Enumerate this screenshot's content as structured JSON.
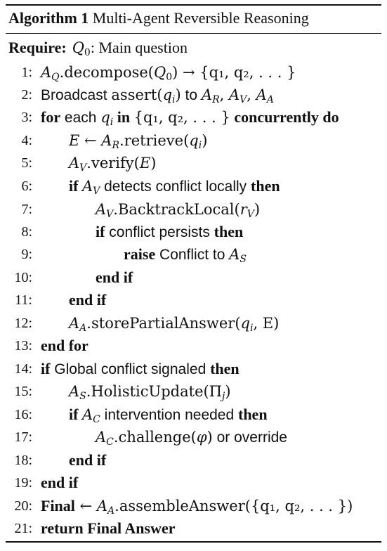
{
  "caption": {
    "label": "Algorithm 1",
    "title": "Multi-Agent Reversible Reasoning"
  },
  "require": {
    "keyword": "Require:",
    "q": "Q",
    "q_sub": "0",
    "text": ": Main question"
  },
  "numbers": [
    "1:",
    "2:",
    "3:",
    "4:",
    "5:",
    "6:",
    "7:",
    "8:",
    "9:",
    "10:",
    "11:",
    "12:",
    "13:",
    "14:",
    "15:",
    "16:",
    "17:",
    "18:",
    "19:",
    "20:",
    "21:"
  ],
  "l1": {
    "a": "A",
    "a_sub": "Q",
    "call": ".decompose(",
    "q": "Q",
    "q_sub": "0",
    "rest": ") → {q₁, q₂, . . . }"
  },
  "l2": {
    "text1": "Broadcast ",
    "fn": "assert(",
    "q": "q",
    "q_sub": "i",
    "close": ")",
    "text2": " to ",
    "targets": [
      {
        "a": "A",
        "sub": "R",
        "sep": ", "
      },
      {
        "a": "A",
        "sub": "V",
        "sep": ", "
      },
      {
        "a": "A",
        "sub": "A",
        "sep": ""
      }
    ]
  },
  "l3": {
    "kw_for": "for",
    "text_each": " each ",
    "q": "q",
    "q_sub": "i",
    "kw_in": " in ",
    "set": "{q₁, q₂, . . . }",
    "kw_do": " concurrently do"
  },
  "l4": {
    "e": "E",
    "arrow": " ← ",
    "a": "A",
    "a_sub": "R",
    "call": ".retrieve(",
    "q": "q",
    "q_sub": "i",
    "close": ")"
  },
  "l5": {
    "a": "A",
    "a_sub": "V",
    "call": ".verify(",
    "e": "E",
    "close": ")"
  },
  "l6": {
    "kw_if": "if",
    "a": "A",
    "a_sub": "V",
    "text": " detects conflict locally ",
    "kw_then": "then"
  },
  "l7": {
    "a": "A",
    "a_sub": "V",
    "call": ".BacktrackLocal(",
    "r": "r",
    "r_sub": "V",
    "close": ")"
  },
  "l8": {
    "kw_if": "if",
    "text": " conflict persists ",
    "kw_then": "then"
  },
  "l9": {
    "kw_raise": "raise",
    "text": " Conflict to ",
    "a": "A",
    "a_sub": "S"
  },
  "l10": {
    "kw": "end if"
  },
  "l11": {
    "kw": "end if"
  },
  "l12": {
    "a": "A",
    "a_sub": "A",
    "call": ".storePartialAnswer(",
    "q": "q",
    "q_sub": "i",
    "rest": ", E)"
  },
  "l13": {
    "kw": "end for"
  },
  "l14": {
    "kw_if": "if",
    "text": " Global conflict signaled ",
    "kw_then": "then"
  },
  "l15": {
    "a": "A",
    "a_sub": "S",
    "call": ".HolisticUpdate(",
    "pi": "Π",
    "pi_sub": "j",
    "close": ")"
  },
  "l16": {
    "kw_if": "if",
    "a": "A",
    "a_sub": "C",
    "text": " intervention needed ",
    "kw_then": "then"
  },
  "l17": {
    "a": "A",
    "a_sub": "C",
    "call": ".challenge(",
    "phi": "φ",
    "close": ")",
    "text": " or ",
    "override": "override"
  },
  "l18": {
    "kw": "end if"
  },
  "l19": {
    "kw": "end if"
  },
  "l20": {
    "kw_final": "Final",
    "arrow": " ← ",
    "a": "A",
    "a_sub": "A",
    "call": ".assembleAnswer(",
    "rest": "{q₁, q₂, . . . })"
  },
  "l21": {
    "kw_return": "return",
    "text": " Final Answer"
  }
}
